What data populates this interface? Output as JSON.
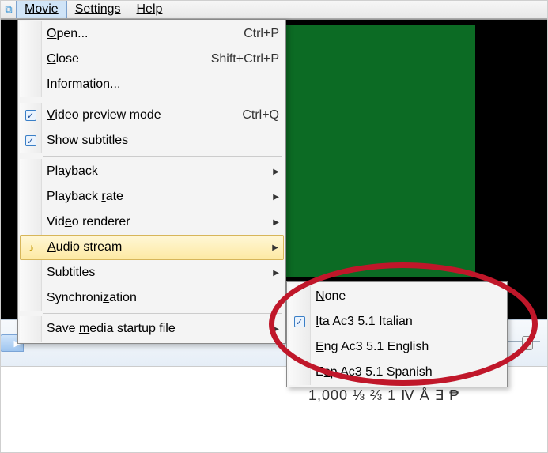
{
  "menubar": {
    "items": [
      "Movie",
      "Settings",
      "Help"
    ],
    "active": "Movie"
  },
  "menu": {
    "open": {
      "label_pre": "",
      "mn": "O",
      "label_post": "pen...",
      "shortcut": "Ctrl+P"
    },
    "close": {
      "label_pre": "",
      "mn": "C",
      "label_post": "lose",
      "shortcut": "Shift+Ctrl+P"
    },
    "information": {
      "label_pre": "",
      "mn": "I",
      "label_post": "nformation..."
    },
    "video_preview": {
      "label_pre": "",
      "mn": "V",
      "label_post": "ideo preview mode",
      "shortcut": "Ctrl+Q",
      "checked": true
    },
    "show_subs": {
      "label_pre": "",
      "mn": "S",
      "label_post": "how subtitles",
      "checked": true
    },
    "playback": {
      "label_pre": "",
      "mn": "P",
      "label_post": "layback"
    },
    "playback_rate": {
      "label_pre": "Playback ",
      "mn": "r",
      "label_post": "ate"
    },
    "video_renderer": {
      "label_pre": "Vid",
      "mn": "e",
      "label_post": "o renderer"
    },
    "audio_stream": {
      "label_pre": "",
      "mn": "A",
      "label_post": "udio stream"
    },
    "subtitles": {
      "label_pre": "S",
      "mn": "u",
      "label_post": "btitles"
    },
    "sync": {
      "label_pre": "Synchroni",
      "mn": "z",
      "label_post": "ation"
    },
    "save_media": {
      "label_pre": "Save ",
      "mn": "m",
      "label_post": "edia startup file"
    }
  },
  "submenu": {
    "none": {
      "label_pre": "",
      "mn": "N",
      "label_post": "one"
    },
    "italian": {
      "label_pre": "",
      "mn": "I",
      "label_post": "ta Ac3 5.1 Italian",
      "checked": true
    },
    "english": {
      "label_pre": "",
      "mn": "E",
      "label_post": "ng Ac3 5.1 English"
    },
    "spanish": {
      "label_pre": "E",
      "mn": "s",
      "label_post": "p Ac3 5.1 Spanish"
    }
  },
  "status": {
    "sample_text": "1,000  ⅓ ⅔ 1 Ⅳ Å ∃ ₱"
  }
}
